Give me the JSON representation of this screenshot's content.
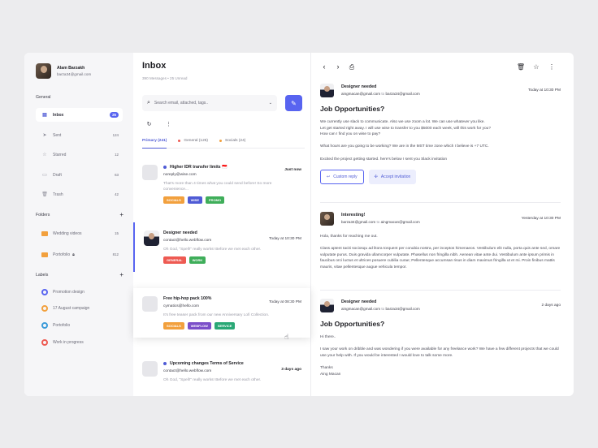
{
  "user": {
    "name": "Alam Barzakh",
    "email": "barza34@gmail.com"
  },
  "sidebar": {
    "general_title": "General",
    "items": [
      {
        "label": "Inbox",
        "count": "25",
        "icon": "inbox-icon"
      },
      {
        "label": "Sent",
        "count": "124",
        "icon": "send-icon"
      },
      {
        "label": "Starred",
        "count": "12",
        "icon": "star-icon"
      },
      {
        "label": "Draft",
        "count": "63",
        "icon": "draft-icon"
      },
      {
        "label": "Trash",
        "count": "42",
        "icon": "trash-icon"
      }
    ],
    "folders_title": "Folders",
    "folders": [
      {
        "label": "Wedding videos",
        "count": "15"
      },
      {
        "label": "Portofolio",
        "count": "812"
      }
    ],
    "labels_title": "Labels",
    "labels": [
      {
        "label": "Promotion design",
        "color": "#5864f0"
      },
      {
        "label": "17 August campaign",
        "color": "#f2a03d"
      },
      {
        "label": "Portofolio",
        "color": "#3b9bd9"
      },
      {
        "label": "Work in progress",
        "color": "#ee5a52"
      }
    ]
  },
  "list": {
    "title": "Inbox",
    "subtitle": "390 Messages • 25 Unread",
    "search_placeholder": "Search email, attached, tags..",
    "tabs": [
      {
        "label": "Primary (241)"
      },
      {
        "label": "General (125)",
        "color": "#ee5a52"
      },
      {
        "label": "Socials (24)",
        "color": "#f2a03d"
      }
    ],
    "mails": [
      {
        "subject": "Higher IDR transfer limits 🇮🇩",
        "from": "noreply@wise.com",
        "date": "Just now",
        "preview": "That's more than 4 times what you could send before! So more convenience...",
        "tags": [
          {
            "label": "SOCIALS",
            "color": "#f2a03d"
          },
          {
            "label": "WISE",
            "color": "#4f5bd5"
          },
          {
            "label": "PROMO",
            "color": "#3fae5a"
          }
        ]
      },
      {
        "subject": "Designer needed",
        "from": "contact@hello.webflow.com",
        "date": "Today at 10:30 PM",
        "preview": "Oh God, \"Spell!\" really works! Before we met each other.",
        "tags": [
          {
            "label": "GENERAL",
            "color": "#ee5a52"
          },
          {
            "label": "WORK",
            "color": "#3fae5a"
          }
        ]
      },
      {
        "subject": "Free hip-hop pack 100%",
        "from": "cymatics@hello.com",
        "date": "Today at 08:30 PM",
        "preview": "It's free teaser pack from our new Anniversary Lofi Collection.",
        "tags": [
          {
            "label": "SOCIALS",
            "color": "#f2a03d"
          },
          {
            "label": "WEBFLOW",
            "color": "#7b4fc9"
          },
          {
            "label": "SERVICE",
            "color": "#2aa876"
          }
        ]
      },
      {
        "subject": "Upcoming changes Terms of Service",
        "from": "contact@hello.webflow.com",
        "date": "3 days ago",
        "preview": "Oh God, \"Spell!\" really works! Before we met each other."
      }
    ]
  },
  "reader": {
    "threads": [
      {
        "name": "Designer needed",
        "from": "aingmacan@gmail.com",
        "to_word": "to",
        "to": "barza34@gmail.com",
        "date": "Today at 10:30 PM",
        "subject": "Job Opportunities?",
        "body": "We currently use slack to communicate. Also we use zoom a lot. We can use whatever you like.\nLet get started right away. I will use wise to transfer to you $5000 each week, will this work for you?\nHow can I find you on wise to pay?\n\nWhat hours are you going to be working? We are in the MST time zone which I believe is +7 UTC.\n\nExcited the project getting started. here's below I sent you Slack invitation",
        "reply_label": "Custom reply",
        "accept_label": "Accept invitation"
      },
      {
        "name": "Interesting!",
        "from": "barza34@gmail.com",
        "to_word": "to",
        "to": "aingmacan@gmail.com",
        "date": "Yesterday at 10:30 PM",
        "body": "Hola, thanks for reaching me out.\n\nClass aptent taciti sociosqu ad litora torquent per conubia nostra, per inceptos himenaeos. Vestibulum elit nulla, porta quis ante sed, ornare vulputate purus. Duis gravida ullamcorper vulputate. Phasellus non fringilla nibh. Aenean vitae ante dui. Vestibulum ante ipsum primis in faucibus orci luctus et ultrices posuere cubilia curae; Pellentesque accumsan risus in diam maximus fringilla ut et mi. Proin finibus mattis mauris, vitae pellentesque augue vehicula tempor."
      },
      {
        "name": "Designer needed",
        "from": "aingmacan@gmail.com",
        "to_word": "to",
        "to": "barza34@gmail.com",
        "date": "2 days ago",
        "subject": "Job Opportunities?",
        "body": "Hi there..\n\nI saw your work on dribble and was wondering if you were available for any freelance work? We have a few different projects that we could use your help with.  If you would be interested I would love to talk some more.\n\nThanks\nAing Macan"
      }
    ]
  }
}
